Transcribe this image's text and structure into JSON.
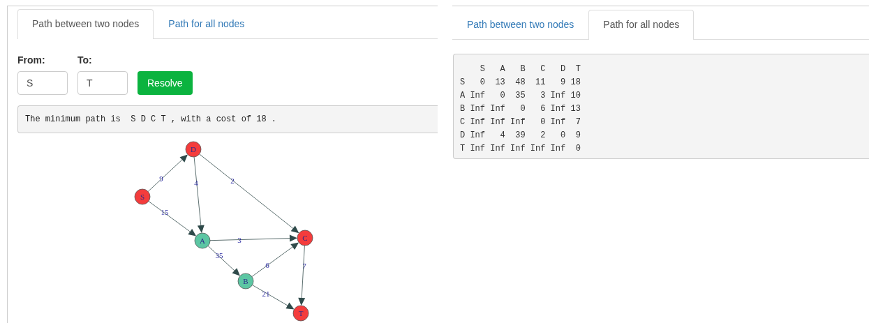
{
  "left_panel": {
    "tabs": [
      {
        "label": "Path between two nodes",
        "selected": true
      },
      {
        "label": "Path for all nodes",
        "selected": false
      }
    ],
    "from": {
      "label": "From:",
      "value": "S"
    },
    "to": {
      "label": "To:",
      "value": "T"
    },
    "resolve_button": "Resolve",
    "result": "The minimum path is  S D C T , with a cost of 18 .",
    "graph": {
      "nodes": [
        {
          "label": "D",
          "color": "#f43c3c"
        },
        {
          "label": "S",
          "color": "#f43c3c"
        },
        {
          "label": "A",
          "color": "#5cc6a3"
        },
        {
          "label": "C",
          "color": "#f43c3c"
        },
        {
          "label": "B",
          "color": "#5cc6a3"
        },
        {
          "label": "T",
          "color": "#f43c3c"
        }
      ],
      "edges": [
        {
          "weight": "9"
        },
        {
          "weight": "4"
        },
        {
          "weight": "2"
        },
        {
          "weight": "15"
        },
        {
          "weight": "3"
        },
        {
          "weight": "35"
        },
        {
          "weight": "6"
        },
        {
          "weight": "7"
        },
        {
          "weight": "21"
        }
      ]
    }
  },
  "right_panel": {
    "tabs": [
      {
        "label": "Path between two nodes",
        "selected": false
      },
      {
        "label": "Path for all nodes",
        "selected": true
      }
    ],
    "matrix_lines": [
      "    S   A   B   C   D  T",
      "S   0  13  48  11   9 18",
      "A Inf   0  35   3 Inf 10",
      "B Inf Inf   0   6 Inf 13",
      "C Inf Inf Inf   0 Inf  7",
      "D Inf   4  39   2   0  9",
      "T Inf Inf Inf Inf Inf  0"
    ]
  }
}
